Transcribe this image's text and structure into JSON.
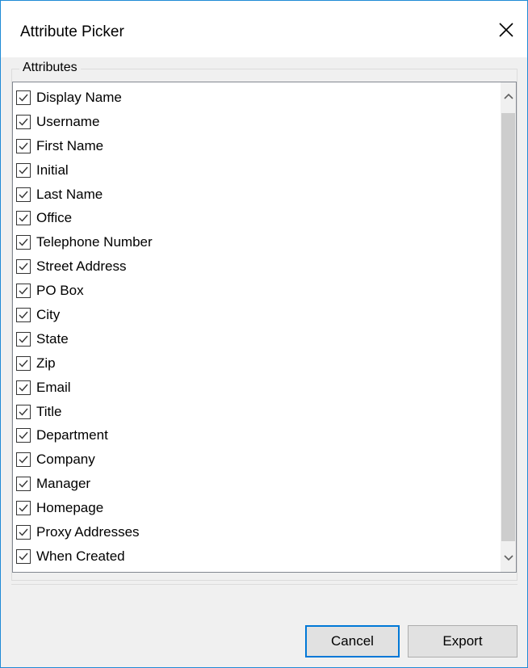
{
  "window": {
    "title": "Attribute Picker"
  },
  "group": {
    "label": "Attributes"
  },
  "attributes": [
    {
      "label": "Display Name",
      "checked": true
    },
    {
      "label": "Username",
      "checked": true
    },
    {
      "label": "First Name",
      "checked": true
    },
    {
      "label": "Initial",
      "checked": true
    },
    {
      "label": "Last Name",
      "checked": true
    },
    {
      "label": "Office",
      "checked": true
    },
    {
      "label": "Telephone Number",
      "checked": true
    },
    {
      "label": "Street Address",
      "checked": true
    },
    {
      "label": "PO Box",
      "checked": true
    },
    {
      "label": "City",
      "checked": true
    },
    {
      "label": "State",
      "checked": true
    },
    {
      "label": "Zip",
      "checked": true
    },
    {
      "label": "Email",
      "checked": true
    },
    {
      "label": "Title",
      "checked": true
    },
    {
      "label": "Department",
      "checked": true
    },
    {
      "label": "Company",
      "checked": true
    },
    {
      "label": "Manager",
      "checked": true
    },
    {
      "label": "Homepage",
      "checked": true
    },
    {
      "label": "Proxy Addresses",
      "checked": true
    },
    {
      "label": "When Created",
      "checked": true
    }
  ],
  "buttons": {
    "cancel": "Cancel",
    "export": "Export"
  },
  "icons": {
    "close": "close-icon",
    "checkmark": "checkmark-icon",
    "scroll_up": "chevron-up-icon",
    "scroll_down": "chevron-down-icon"
  },
  "colors": {
    "window_border": "#1f8bd6",
    "default_button_border": "#0078d7",
    "button_face": "#e1e1e1",
    "dialog_background": "#f0f0f0"
  }
}
